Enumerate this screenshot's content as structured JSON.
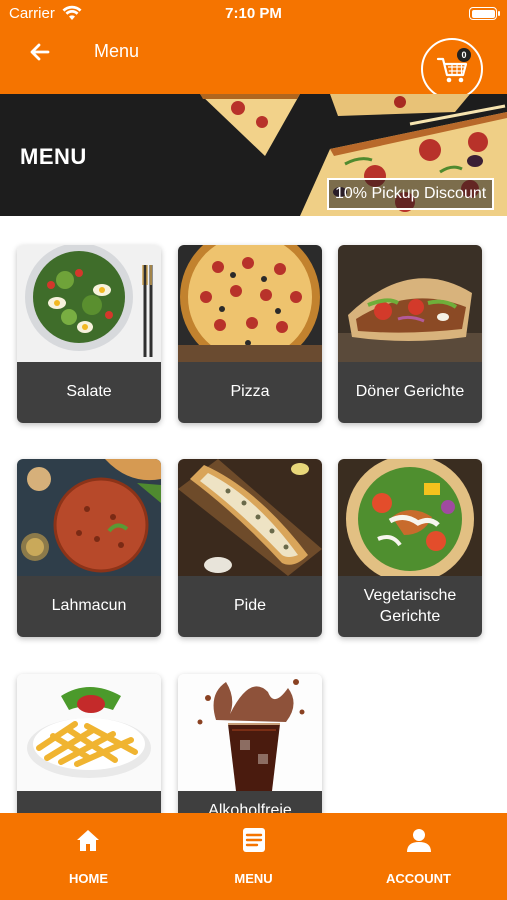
{
  "status_bar": {
    "carrier": "Carrier",
    "time": "7:10 PM"
  },
  "nav": {
    "title": "Menu",
    "cart_count": "0"
  },
  "banner": {
    "heading": "MENU",
    "discount": "10% Pickup Discount"
  },
  "categories": [
    {
      "label": "Salate"
    },
    {
      "label": "Pizza"
    },
    {
      "label": "Döner Gerichte"
    },
    {
      "label": "Lahmacun"
    },
    {
      "label": "Pide"
    },
    {
      "label": "Vegetarische Gerichte"
    },
    {
      "label": ""
    },
    {
      "label": "Alkoholfreie"
    }
  ],
  "tabs": [
    {
      "label": "HOME",
      "icon": "home-icon"
    },
    {
      "label": "MENU",
      "icon": "menu-list-icon"
    },
    {
      "label": "ACCOUNT",
      "icon": "account-icon"
    }
  ],
  "colors": {
    "brand_orange": "#f57400",
    "card_label_bg": "#3f3f3f",
    "banner_bg": "#1d1d1d"
  }
}
